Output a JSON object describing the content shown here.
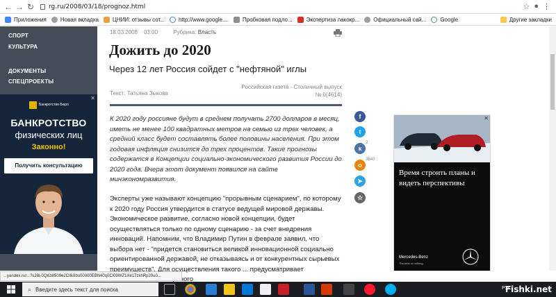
{
  "browser": {
    "url": "rg.ru/2008/03/18/prognoz.html",
    "bookmarks": [
      "Приложения",
      "Новая вкладка",
      "ЦНИИ: отзывы сот...",
      "http://www.google....",
      "Пробковая подло...",
      "Экспертиза лакокр...",
      "Официальный сай...",
      "Google"
    ],
    "other_bookmarks": "Другие закладки"
  },
  "sidebar": {
    "items": [
      "СПОРТ",
      "КУЛЬТУРА",
      "ДОКУМЕНТЫ",
      "СПЕЦПРОЕКТЫ"
    ]
  },
  "banner_left": {
    "logo_text": "Банкротство Бюро",
    "line1": "БАНКРОТСТВО",
    "line2": "физических лиц",
    "line3": "Законно!",
    "button": "Получить консультацию"
  },
  "article": {
    "date": "18.03.2008",
    "time": "03:00",
    "rubric_label": "Рубрика:",
    "rubric": "Власть",
    "title": "Дожить до 2020",
    "subtitle": "Через 12 лет Россия сойдет с \"нефтяной\" иглы",
    "issue_line1": "Российская газета - Столичный выпуск",
    "issue_line2": "№ 0(4614)",
    "author": "Текст: Татьяна Зыкова",
    "lead": "К 2020 году россияне будут в среднем получать 2700 долларов в месяц, иметь не менее 100 квадратных метров на семью из трех человек, а средний класс будет составлять более половины населения. При этом годовая инфляция снизится до трех процентов. Такие прогнозы содержатся в Концепции социально-экономического развития России до 2020 года. Вчера этот документ появился на сайте минэкономразвития.",
    "body": "Эксперты уже называют концепцию \"прорывным сценарием\", по которому к 2020 году Россия утвердится в статусе ведущей мировой державы. Экономическое развитие, согласно новой концепции, будет осуществляться только по одному сценарию - за счет внедрения инноваций. Напомним, что Владимир Путин в феврале заявил, что выбора нет - \"придется становиться великой инновационной социально ориентированной державой, не отказываясь и от конкурентных сырьевых преимуществ\". Для осуществления такого ... предусматривает использование Резервного"
  },
  "social": {
    "vk_count": "2",
    "ok_count": "3840"
  },
  "ad_right": {
    "text": "Время строить планы и видеть перспективы",
    "brand": "Mercedes-Benz",
    "tagline": "The best or nothing."
  },
  "status_url": "...yandex.ru/...?s28l-0QKb8509e2CIlk8bu00000EBhH0q0Cl09WZ1Xe17zkhRp20u0...",
  "taskbar": {
    "search_placeholder": "Введите здесь текст для поиска",
    "lang": "РУС",
    "watermark": "Fishki.net"
  },
  "colors": {
    "sidebar": "#444c58",
    "banner_bg": "#15253a",
    "banner_accent": "#f2c200",
    "facebook": "#3b5998",
    "twitter": "#1da1f2",
    "vk": "#4a76a8",
    "ok": "#ee8208",
    "telegram": "#2aa3df",
    "favorite": "#666666"
  }
}
